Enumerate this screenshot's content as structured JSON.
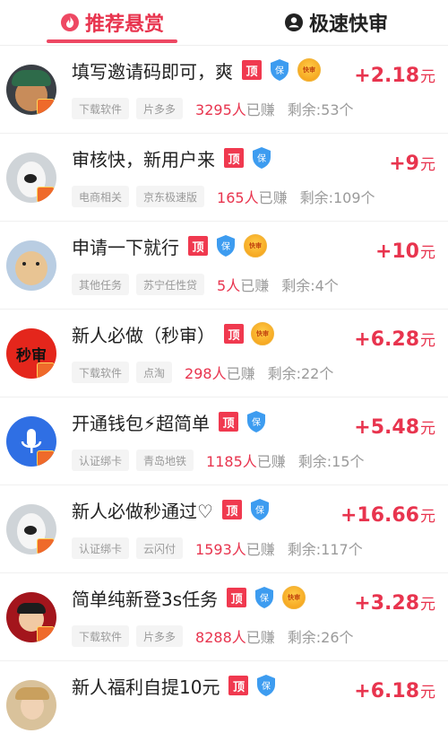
{
  "tabs": [
    {
      "label": "推荐悬赏",
      "icon": "flame-icon",
      "active": true
    },
    {
      "label": "极速快审",
      "icon": "user-circle-icon",
      "active": false
    }
  ],
  "colors": {
    "accent": "#e8344e",
    "tag_bg": "#f4f4f4",
    "muted": "#9a9a9a"
  },
  "badges": {
    "top": "顶",
    "guarantee": "保",
    "fast": "快审"
  },
  "tasks": [
    {
      "title": "填写邀请码即可，爽",
      "fast": true,
      "guarantee": true,
      "price": "+2.18",
      "unit": "元",
      "tags": [
        "下载软件",
        "片多多"
      ],
      "earned_count": "3295人",
      "earned_label": "已赚",
      "remaining": "剩余:53个"
    },
    {
      "title": "审核快，新用户来",
      "fast": false,
      "guarantee": true,
      "price": "+9",
      "unit": "元",
      "tags": [
        "电商相关",
        "京东极速版"
      ],
      "earned_count": "165人",
      "earned_label": "已赚",
      "remaining": "剩余:109个"
    },
    {
      "title": "申请一下就行",
      "fast": true,
      "guarantee": true,
      "price": "+10",
      "unit": "元",
      "tags": [
        "其他任务",
        "苏宁任性贷"
      ],
      "earned_count": "5人",
      "earned_label": "已赚",
      "remaining": "剩余:4个"
    },
    {
      "title": "新人必做（秒审）",
      "fast": true,
      "guarantee": false,
      "price": "+6.28",
      "unit": "元",
      "tags": [
        "下载软件",
        "点淘"
      ],
      "earned_count": "298人",
      "earned_label": "已赚",
      "remaining": "剩余:22个",
      "avatar_text": "秒审"
    },
    {
      "title": "开通钱包⚡超简单",
      "fast": false,
      "guarantee": true,
      "price": "+5.48",
      "unit": "元",
      "tags": [
        "认证绑卡",
        "青岛地铁"
      ],
      "earned_count": "1185人",
      "earned_label": "已赚",
      "remaining": "剩余:15个"
    },
    {
      "title": "新人必做秒通过♡",
      "fast": false,
      "guarantee": true,
      "price": "+16.66",
      "unit": "元",
      "tags": [
        "认证绑卡",
        "云闪付"
      ],
      "earned_count": "1593人",
      "earned_label": "已赚",
      "remaining": "剩余:117个"
    },
    {
      "title": "简单纯新登3s任务",
      "fast": true,
      "guarantee": true,
      "price": "+3.28",
      "unit": "元",
      "tags": [
        "下载软件",
        "片多多"
      ],
      "earned_count": "8288人",
      "earned_label": "已赚",
      "remaining": "剩余:26个"
    },
    {
      "title": "新人福利自提10元",
      "fast": false,
      "guarantee": true,
      "price": "+6.18",
      "unit": "元",
      "tags": [],
      "earned_count": "",
      "earned_label": "",
      "remaining": ""
    }
  ]
}
